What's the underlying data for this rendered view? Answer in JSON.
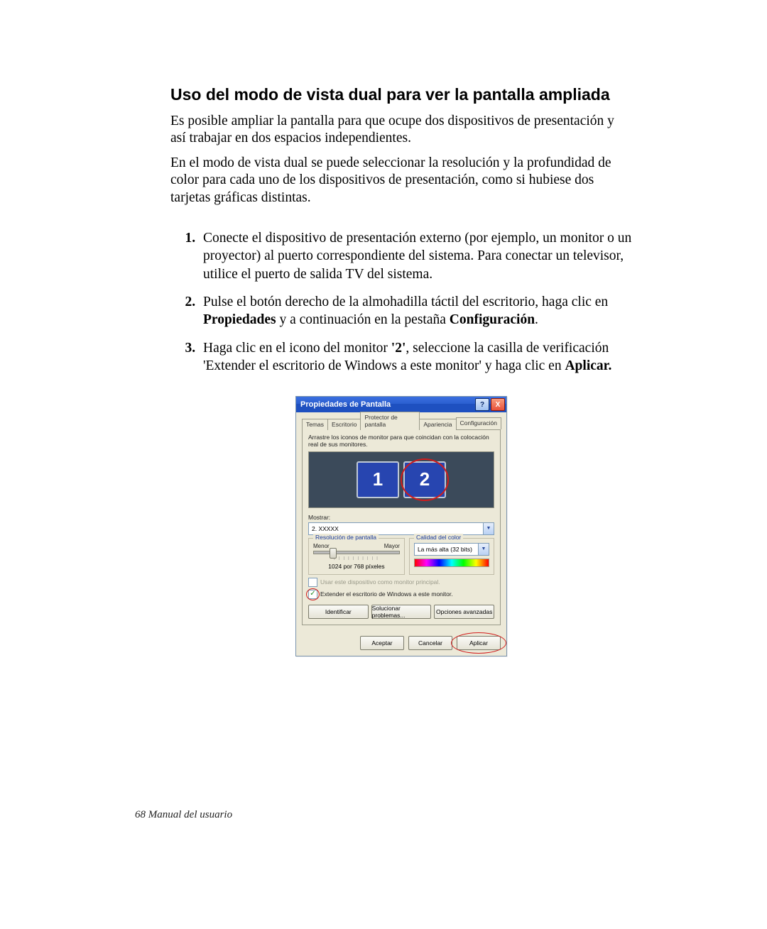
{
  "heading": "Uso del modo de vista dual para ver la pantalla ampliada",
  "para1": "Es posible ampliar la pantalla para que ocupe dos dispositivos de presentación y así trabajar en dos espacios independientes.",
  "para2": "En el modo de vista dual se puede seleccionar la resolución y la profundidad de color para cada uno de los dispositivos de presentación, como si hubiese dos tarjetas gráficas distintas.",
  "steps": {
    "s1": "Conecte el dispositivo de presentación externo (por ejemplo, un monitor o un proyector) al puerto correspondiente del sistema. Para conectar un televisor, utilice el puerto de salida TV del sistema.",
    "s2_a": "Pulse el botón derecho de la almohadilla táctil del escritorio, haga clic en ",
    "s2_b1": "Propiedades",
    "s2_b": " y a continuación en la pestaña ",
    "s2_b2": "Configuración",
    "s2_c": ".",
    "s3_a": "Haga clic en el icono del monitor ",
    "s3_b1": "'2'",
    "s3_b": ", seleccione la casilla de verificación 'Extender el escritorio de Windows a este monitor' y haga clic en ",
    "s3_b2": "Aplicar.",
    "s3_c": ""
  },
  "dialog": {
    "title": "Propiedades de Pantalla",
    "tabs": {
      "t1": "Temas",
      "t2": "Escritorio",
      "t3": "Protector de pantalla",
      "t4": "Apariencia",
      "t5": "Configuración"
    },
    "instruction": "Arrastre los iconos de monitor para que coincidan con la colocación real de sus monitores.",
    "mon1": "1",
    "mon2": "2",
    "mostrar_label": "Mostrar:",
    "mostrar_value": "2. XXXXX",
    "res_legend": "Resolución de pantalla",
    "res_min": "Menor",
    "res_max": "Mayor",
    "res_value": "1024 por 768 píxeles",
    "color_legend": "Calidad del color",
    "color_value": "La más alta (32 bits)",
    "chk_primary": "Usar este dispositivo como monitor principal.",
    "chk_extend": "Extender el escritorio de Windows a este monitor.",
    "btn_identify": "Identificar",
    "btn_trouble": "Solucionar problemas...",
    "btn_advanced": "Opciones avanzadas",
    "btn_ok": "Aceptar",
    "btn_cancel": "Cancelar",
    "btn_apply": "Aplicar",
    "help_btn": "?",
    "close_btn": "X"
  },
  "footer": {
    "page_no": "68",
    "label": "Manual del usuario"
  }
}
